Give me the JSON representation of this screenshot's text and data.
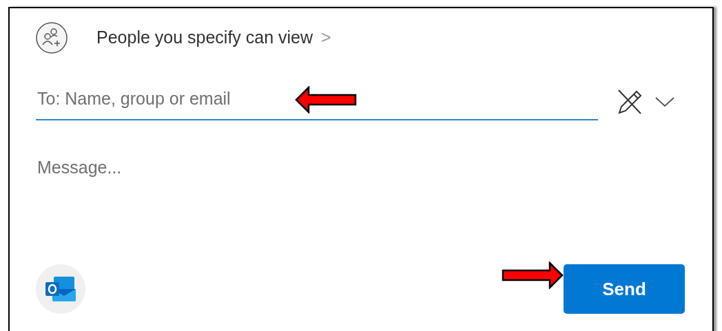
{
  "share_link": {
    "label": "People you specify can view",
    "chevron": ">"
  },
  "recipient_field": {
    "placeholder": "To: Name, group or email"
  },
  "message_field": {
    "placeholder": "Message..."
  },
  "send_button": {
    "label": "Send"
  },
  "annotations": [
    {
      "kind": "left-arrow"
    },
    {
      "kind": "right-arrow"
    }
  ]
}
